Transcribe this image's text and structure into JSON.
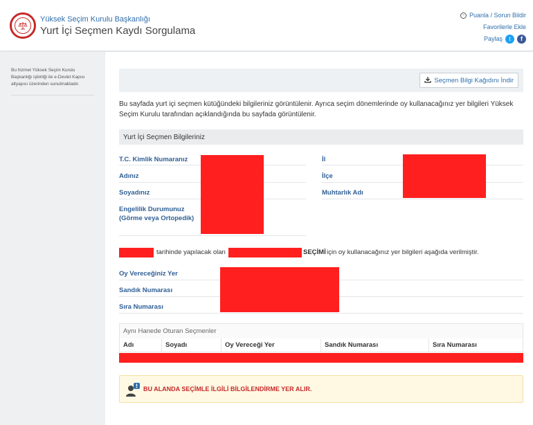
{
  "header": {
    "org_name": "Yüksek Seçim Kurulu Başkanlığı",
    "app_title": "Yurt İçi Seçmen Kaydı Sorgulama",
    "links": {
      "feedback": "Puanla / Sorun Bildir",
      "favorites": "Favorilerle Ekle",
      "share": "Paylaş"
    }
  },
  "sidebar": {
    "note": "Bu hizmet Yüksek Seçim Kurulu Başkanlığı işbirliği ile e-Devlet Kapısı altyapısı üzerinden sunulmaktadır."
  },
  "main": {
    "download_label": "Seçmen Bilgi Kağıdını İndir",
    "intro": "Bu sayfada yurt içi seçmen kütüğündeki bilgileriniz görüntülenir. Ayrıca seçim dönemlerinde oy kullanacağınız yer bilgileri Yüksek Seçim Kurulu tarafından açıklandığında bu sayfada görüntülenir.",
    "section_title": "Yurt İçi Seçmen Bilgileriniz",
    "fields_left": {
      "tc": "T.C. Kimlik Numaranız",
      "name": "Adınız",
      "surname": "Soyadınız",
      "disability": "Engelilik Durumunuz (Görme veya Ortopedik)"
    },
    "fields_right": {
      "province": "İl",
      "district": "İlçe",
      "neighborhood": "Muhtarlık Adı"
    },
    "sentence": {
      "part1": "tarihinde yapılacak olan",
      "bold": "SEÇİMİ",
      "part2": "için oy kullanacağınız yer bilgileri aşağıda verilmiştir."
    },
    "vote_fields": {
      "place": "Oy Vereceğiniz Yer",
      "box_no": "Sandık Numarası",
      "seq_no": "Sıra Numarası"
    },
    "household": {
      "title": "Aynı Hanede Oturan Seçmenler",
      "columns": [
        "Adı",
        "Soyadı",
        "Oy Vereceği Yer",
        "Sandık Numarası",
        "Sıra Numarası"
      ]
    },
    "info_message": "BU ALANDA SEÇİMLE İLGİLİ BİLGİLENDİRME YER ALIR."
  },
  "colors": {
    "link": "#2f6fab",
    "label": "#2f5f95",
    "redaction": "#ff1f1f",
    "warning_text": "#c62828",
    "warning_bg": "#fff9e3"
  }
}
